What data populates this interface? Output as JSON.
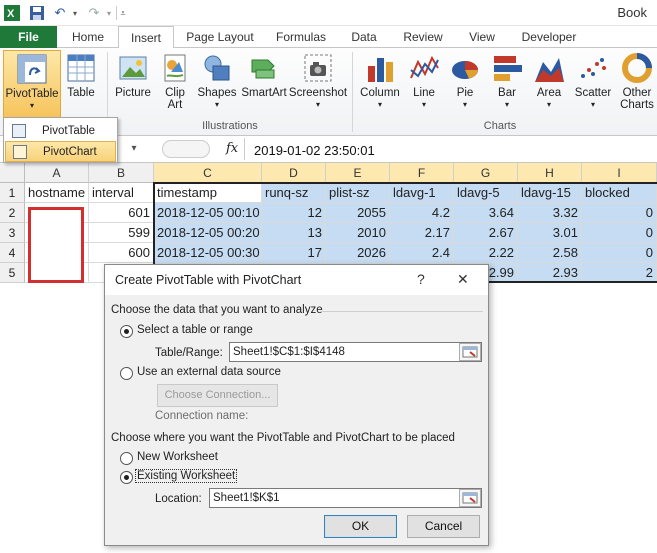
{
  "titlebar": {
    "book_title": "Book"
  },
  "tabs": [
    "File",
    "Home",
    "Insert",
    "Page Layout",
    "Formulas",
    "Data",
    "Review",
    "View",
    "Developer"
  ],
  "active_tab": "Insert",
  "ribbon": {
    "tables": [
      "PivotTable",
      "Table"
    ],
    "illustrations": [
      "Picture",
      "Clip Art",
      "Shapes",
      "SmartArt",
      "Screenshot"
    ],
    "charts": [
      "Column",
      "Line",
      "Pie",
      "Bar",
      "Area",
      "Scatter",
      "Other Charts"
    ],
    "group_labels": {
      "illustrations": "Illustrations",
      "charts": "Charts"
    }
  },
  "dropdown": {
    "items": [
      "PivotTable",
      "PivotChart"
    ],
    "highlighted": "PivotChart"
  },
  "formula_bar": {
    "value": "2019-01-02  23:50:01",
    "fx": "fx"
  },
  "grid": {
    "columns": [
      "A",
      "B",
      "C",
      "D",
      "E",
      "F",
      "G",
      "H",
      "I"
    ],
    "rows": [
      "1",
      "2",
      "3",
      "4",
      "5"
    ],
    "header_row": [
      "hostname",
      "interval",
      "timestamp",
      "runq-sz",
      "plist-sz",
      "ldavg-1",
      "ldavg-5",
      "ldavg-15",
      "blocked"
    ],
    "data": [
      [
        "",
        "601",
        "2018-12-05 00:10",
        "12",
        "2055",
        "4.2",
        "3.64",
        "3.32",
        "0"
      ],
      [
        "",
        "599",
        "2018-12-05 00:20",
        "13",
        "2010",
        "2.17",
        "2.67",
        "3.01",
        "0"
      ],
      [
        "",
        "600",
        "2018-12-05 00:30",
        "17",
        "2026",
        "2.4",
        "2.22",
        "2.58",
        "0"
      ],
      [
        "",
        "",
        "",
        "",
        "",
        "",
        "2.99",
        "2.93",
        "2"
      ]
    ]
  },
  "dialog": {
    "title": "Create PivotTable with PivotChart",
    "help": "?",
    "close": "✕",
    "section1": "Choose the data that you want to analyze",
    "opt_select_table": "Select a table or range",
    "table_range_label": "Table/Range:",
    "table_range_value": "Sheet1!$C$1:$I$4148",
    "opt_external": "Use an external data source",
    "choose_connection": "Choose Connection...",
    "connection_name": "Connection name:",
    "section2": "Choose where you want the PivotTable and PivotChart to be placed",
    "opt_new_ws": "New Worksheet",
    "opt_existing_ws": "Existing Worksheet",
    "location_label": "Location:",
    "location_value": "Sheet1!$K$1",
    "ok": "OK",
    "cancel": "Cancel"
  }
}
